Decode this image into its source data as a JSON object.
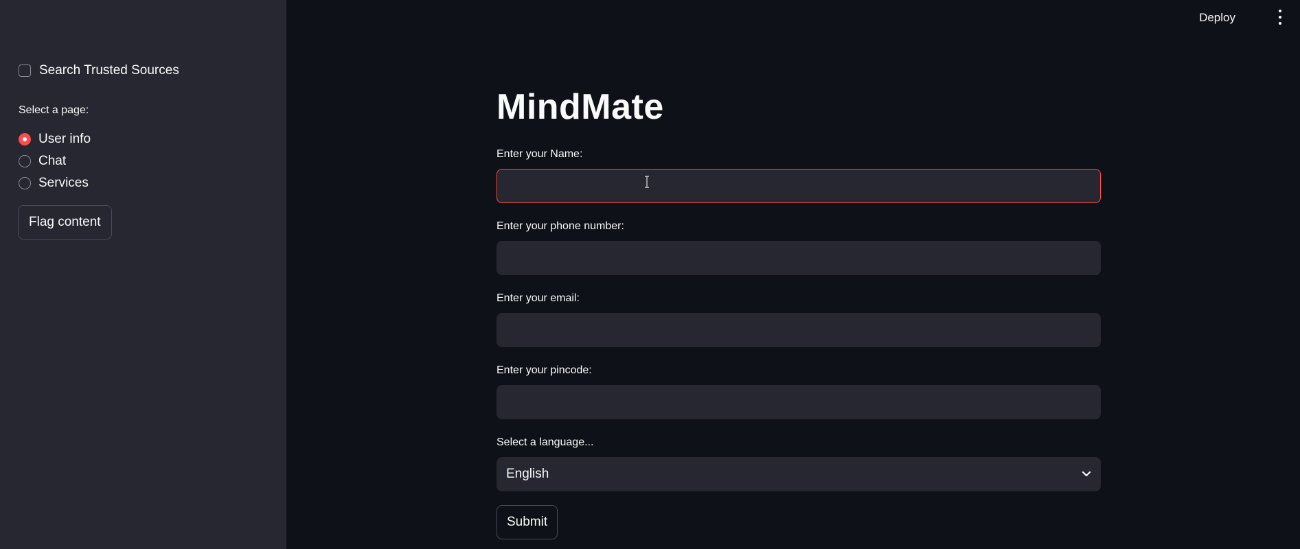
{
  "header": {
    "deploy_label": "Deploy",
    "menu_icon": "kebab-menu-icon"
  },
  "sidebar": {
    "search_checkbox": {
      "label": "Search Trusted Sources",
      "checked": false
    },
    "page_select_label": "Select a page:",
    "pages": [
      {
        "label": "User info",
        "selected": true
      },
      {
        "label": "Chat",
        "selected": false
      },
      {
        "label": "Services",
        "selected": false
      }
    ],
    "flag_button_label": "Flag content"
  },
  "main": {
    "title": "MindMate",
    "fields": {
      "name": {
        "label": "Enter your Name:",
        "value": ""
      },
      "phone": {
        "label": "Enter your phone number:",
        "value": ""
      },
      "email": {
        "label": "Enter your email:",
        "value": ""
      },
      "pincode": {
        "label": "Enter your pincode:",
        "value": ""
      }
    },
    "language": {
      "label": "Select a language...",
      "selected": "English"
    },
    "submit_label": "Submit"
  },
  "colors": {
    "background": "#0e1117",
    "sidebar": "#262730",
    "input": "#262730",
    "accent": "#ff4b4b",
    "text": "#fafafa"
  }
}
